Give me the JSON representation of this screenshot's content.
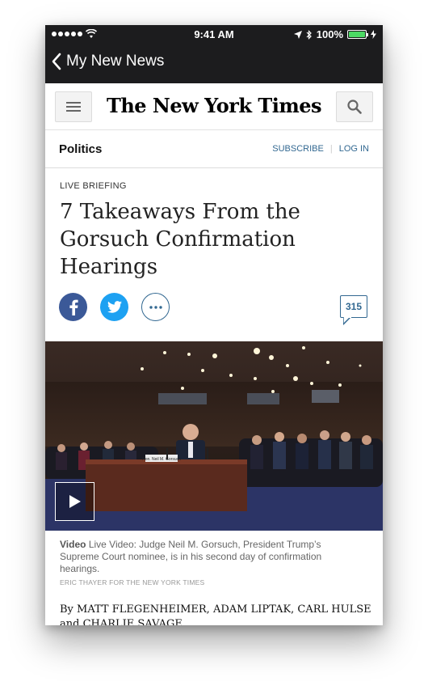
{
  "status_bar": {
    "time": "9:41 AM",
    "battery": "100%",
    "battery_color": "#4cd964",
    "icons": [
      "signal-dots-icon",
      "wifi-icon",
      "location-arrow-icon",
      "bluetooth-icon",
      "battery-icon",
      "charging-bolt-icon"
    ]
  },
  "nav": {
    "back_label": "My New News",
    "back_icon": "chevron-left-icon"
  },
  "nyt_header": {
    "masthead": "The New York Times",
    "menu_icon": "hamburger-menu-icon",
    "search_icon": "search-icon"
  },
  "section": {
    "name": "Politics",
    "subscribe": "SUBSCRIBE",
    "login": "LOG IN",
    "link_color": "#326891"
  },
  "article": {
    "kicker": "LIVE BRIEFING",
    "headline": "7 Takeaways From the Gorsuch Confirmation Hearings",
    "comment_count": "315",
    "share_icons": [
      "facebook-icon",
      "twitter-icon",
      "more-dots-icon"
    ],
    "caption_label": "Video",
    "caption_text": "Live Video: Judge Neil M. Gorsuch, President Trump’s Supreme Court nominee, is in his second day of confirmation hearings.",
    "credit": "ERIC THAYER FOR THE NEW YORK TIMES",
    "byline": "By MATT FLEGENHEIMER, ADAM LIPTAK, CARL HULSE and CHARLIE SAVAGE",
    "nameplate": "Hon. Neil M. Gorsuch"
  }
}
